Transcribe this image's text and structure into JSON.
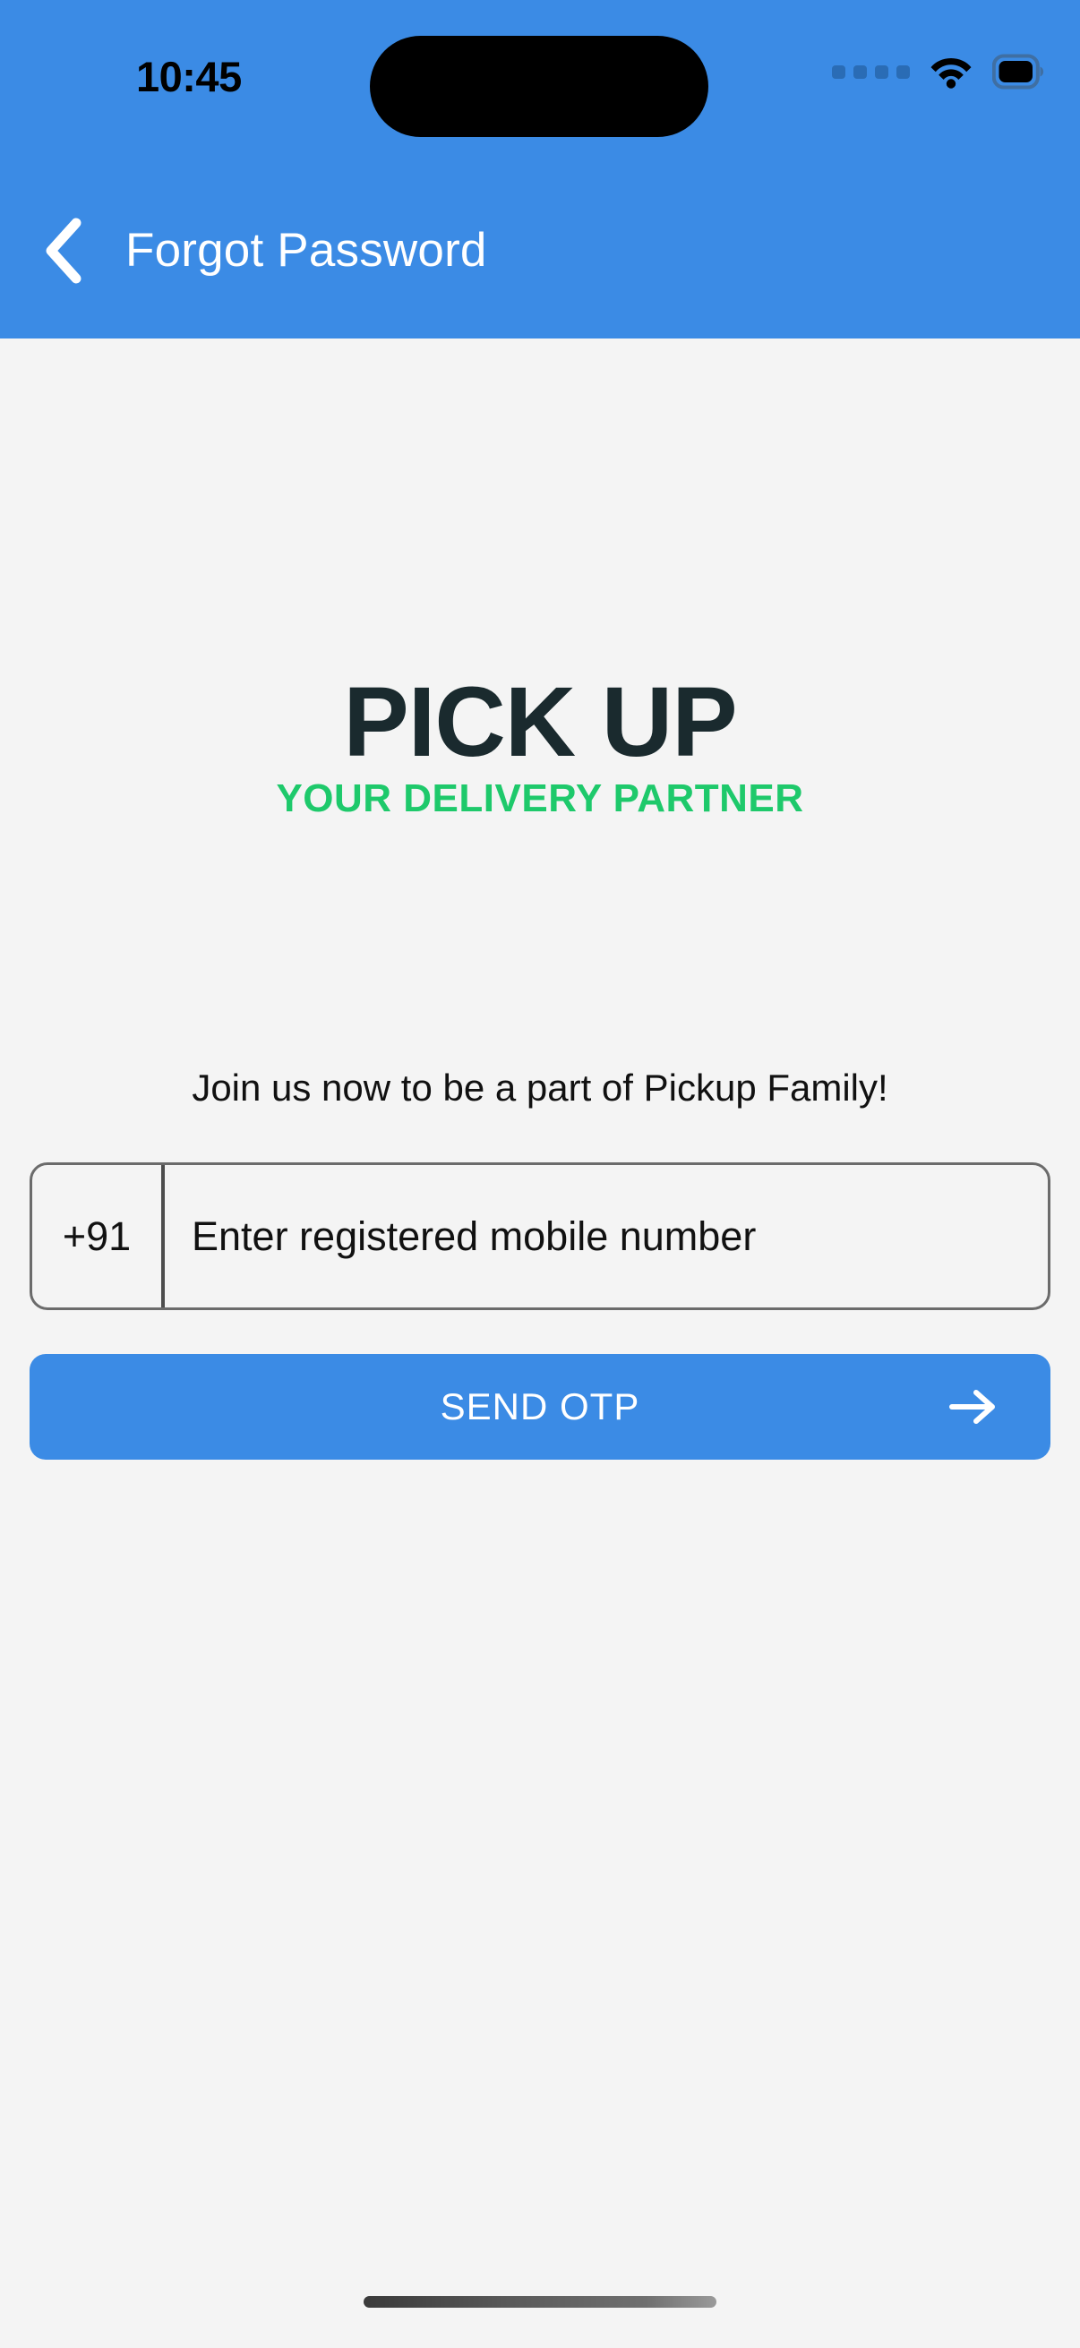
{
  "status_bar": {
    "time": "10:45",
    "icons": [
      "signal-dots-icon",
      "wifi-icon",
      "battery-icon"
    ]
  },
  "header": {
    "title": "Forgot Password",
    "back_icon": "chevron-left-icon",
    "background_color": "#3b8be5",
    "title_color": "#ffffff"
  },
  "logo": {
    "main": "PICK UP",
    "tagline": "YOUR DELIVERY PARTNER",
    "main_color": "#1a2a2e",
    "tagline_color": "#1ec96b"
  },
  "main": {
    "heading": "Join us now to be a part of Pickup Family!",
    "phone_field": {
      "country_code": "+91",
      "placeholder": "Enter registered mobile number",
      "value": ""
    },
    "submit": {
      "label": "SEND OTP",
      "arrow_icon": "arrow-right-icon",
      "background_color": "#3b8be5"
    }
  },
  "page_background": "#f4f4f4"
}
